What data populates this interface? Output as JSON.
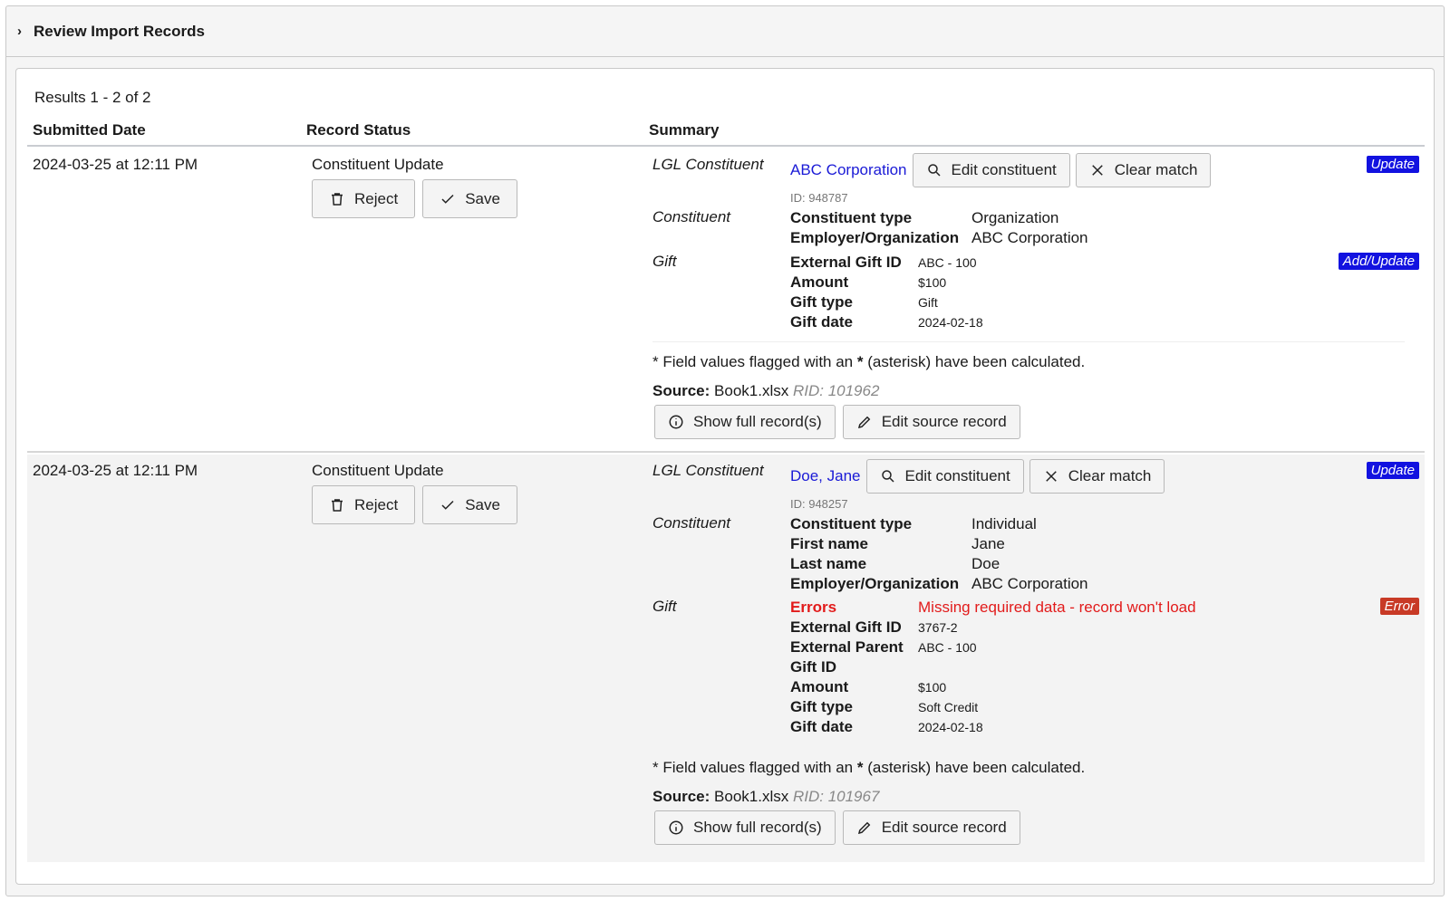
{
  "panel": {
    "title": "Review Import Records"
  },
  "results_text": "Results 1 - 2 of 2",
  "columns": {
    "date": "Submitted Date",
    "status": "Record Status",
    "summary": "Summary"
  },
  "labels": {
    "lgl_constituent": "LGL Constituent",
    "constituent": "Constituent",
    "gift": "Gift",
    "reject": "Reject",
    "save": "Save",
    "edit_constituent": "Edit constituent",
    "clear_match": "Clear match",
    "note_pre": "* Field values flagged with an ",
    "note_star": "*",
    "note_post": " (asterisk) have been calculated.",
    "source_label": "Source:",
    "show_full": "Show full record(s)",
    "edit_source": "Edit source record"
  },
  "records": [
    {
      "date": "2024-03-25 at 12:11 PM",
      "status": "Constituent Update",
      "lgl_name": "ABC Corporation",
      "lgl_id": "ID: 948787",
      "lgl_badge": "Update",
      "constituent_fields": [
        {
          "k": "Constituent type",
          "v": "Organization"
        },
        {
          "k": "Employer/Organization",
          "v": "ABC Corporation"
        }
      ],
      "gift_badge": "Add/Update",
      "gift_fields": [
        {
          "k": "External Gift ID",
          "v": "ABC - 100"
        },
        {
          "k": "Amount",
          "v": "$100"
        },
        {
          "k": "Gift type",
          "v": "Gift"
        },
        {
          "k": "Gift date",
          "v": "2024-02-18"
        }
      ],
      "source_file": "Book1.xlsx",
      "rid": "RID: 101962"
    },
    {
      "date": "2024-03-25 at 12:11 PM",
      "status": "Constituent Update",
      "lgl_name": "Doe, Jane",
      "lgl_id": "ID: 948257",
      "lgl_badge": "Update",
      "constituent_fields": [
        {
          "k": "Constituent type",
          "v": "Individual"
        },
        {
          "k": "First name",
          "v": "Jane"
        },
        {
          "k": "Last name",
          "v": "Doe"
        },
        {
          "k": "Employer/Organization",
          "v": "ABC Corporation"
        }
      ],
      "gift_badge": "Error",
      "gift_errors_key": "Errors",
      "gift_errors_val": "Missing required data - record won't load",
      "gift_fields": [
        {
          "k": "External Gift ID",
          "v": "3767-2"
        },
        {
          "k": "External Parent",
          "v": "ABC - 100"
        },
        {
          "k": "Gift ID",
          "v": ""
        },
        {
          "k": "Amount",
          "v": "$100"
        },
        {
          "k": "Gift type",
          "v": "Soft Credit"
        },
        {
          "k": "Gift date",
          "v": "2024-02-18"
        }
      ],
      "source_file": "Book1.xlsx",
      "rid": "RID: 101967"
    }
  ]
}
